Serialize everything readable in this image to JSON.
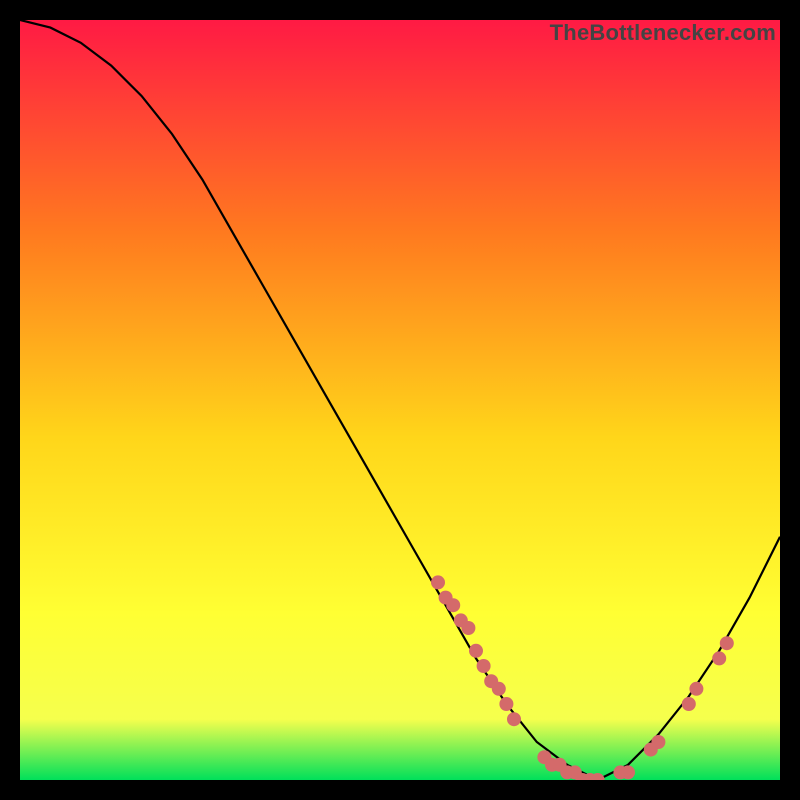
{
  "watermark": "TheBottleneсker.com",
  "colors": {
    "top": "#ff1a44",
    "mid_upper": "#ff7a1f",
    "mid": "#ffd61a",
    "mid_lower": "#ffff33",
    "lower": "#f5ff4d",
    "bottom": "#00e05a",
    "curve": "#000000",
    "dot": "#d46a6a"
  },
  "chart_data": {
    "type": "line",
    "title": "",
    "xlabel": "",
    "ylabel": "",
    "xlim": [
      0,
      100
    ],
    "ylim": [
      0,
      100
    ],
    "series": [
      {
        "name": "curve",
        "x": [
          0,
          4,
          8,
          12,
          16,
          20,
          24,
          28,
          32,
          36,
          40,
          44,
          48,
          52,
          56,
          60,
          64,
          68,
          72,
          76,
          80,
          84,
          88,
          92,
          96,
          100
        ],
        "y": [
          100,
          99,
          97,
          94,
          90,
          85,
          79,
          72,
          65,
          58,
          51,
          44,
          37,
          30,
          23,
          16,
          10,
          5,
          2,
          0,
          2,
          6,
          11,
          17,
          24,
          32
        ]
      }
    ],
    "dots": [
      {
        "x": 55,
        "y": 26
      },
      {
        "x": 56,
        "y": 24
      },
      {
        "x": 57,
        "y": 23
      },
      {
        "x": 58,
        "y": 21
      },
      {
        "x": 59,
        "y": 20
      },
      {
        "x": 60,
        "y": 17
      },
      {
        "x": 61,
        "y": 15
      },
      {
        "x": 62,
        "y": 13
      },
      {
        "x": 63,
        "y": 12
      },
      {
        "x": 64,
        "y": 10
      },
      {
        "x": 65,
        "y": 8
      },
      {
        "x": 69,
        "y": 3
      },
      {
        "x": 70,
        "y": 2
      },
      {
        "x": 71,
        "y": 2
      },
      {
        "x": 72,
        "y": 1
      },
      {
        "x": 73,
        "y": 1
      },
      {
        "x": 74,
        "y": 0
      },
      {
        "x": 75,
        "y": 0
      },
      {
        "x": 76,
        "y": 0
      },
      {
        "x": 79,
        "y": 1
      },
      {
        "x": 80,
        "y": 1
      },
      {
        "x": 83,
        "y": 4
      },
      {
        "x": 84,
        "y": 5
      },
      {
        "x": 88,
        "y": 10
      },
      {
        "x": 89,
        "y": 12
      },
      {
        "x": 92,
        "y": 16
      },
      {
        "x": 93,
        "y": 18
      }
    ]
  }
}
